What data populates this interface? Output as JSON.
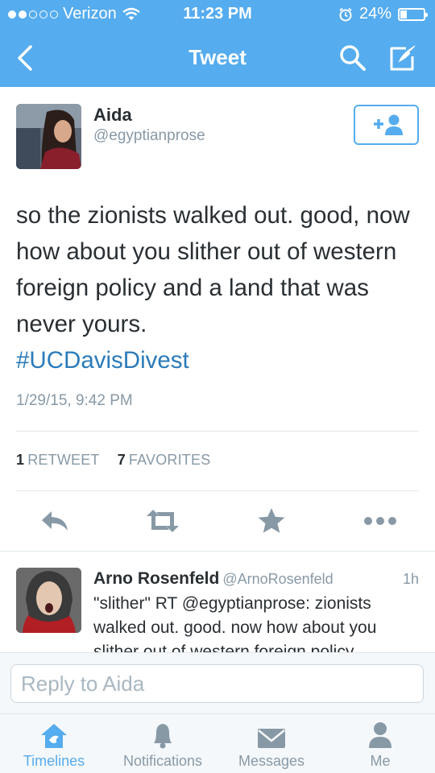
{
  "status_bar": {
    "carrier": "Verizon",
    "time": "11:23 PM",
    "battery": "24%"
  },
  "nav": {
    "title": "Tweet"
  },
  "tweet": {
    "author_name": "Aida",
    "author_handle": "@egyptianprose",
    "text": "so the zionists walked out. good, now how about you slither out of western foreign policy and a land that was never yours.",
    "hashtag": "#UCDavisDivest",
    "timestamp": "1/29/15, 9:42 PM",
    "retweet_count": "1",
    "retweet_label": "RETWEET",
    "favorite_count": "7",
    "favorite_label": "FAVORITES"
  },
  "reply_preview": {
    "author_name": "Arno Rosenfeld",
    "author_handle": "@ArnoRosenfeld",
    "time": "1h",
    "text": "\"slither\" RT @egyptianprose: zionists walked out. good. now how about you slither out of western foreign policy"
  },
  "reply_box": {
    "placeholder": "Reply to Aida"
  },
  "tabs": [
    {
      "label": "Timelines",
      "icon": "home-icon",
      "active": true
    },
    {
      "label": "Notifications",
      "icon": "bell-icon",
      "active": false
    },
    {
      "label": "Messages",
      "icon": "envelope-icon",
      "active": false
    },
    {
      "label": "Me",
      "icon": "person-icon",
      "active": false
    }
  ],
  "colors": {
    "brand": "#55acee",
    "link": "#2b7bb9",
    "muted": "#8899a6",
    "text": "#292f33"
  }
}
